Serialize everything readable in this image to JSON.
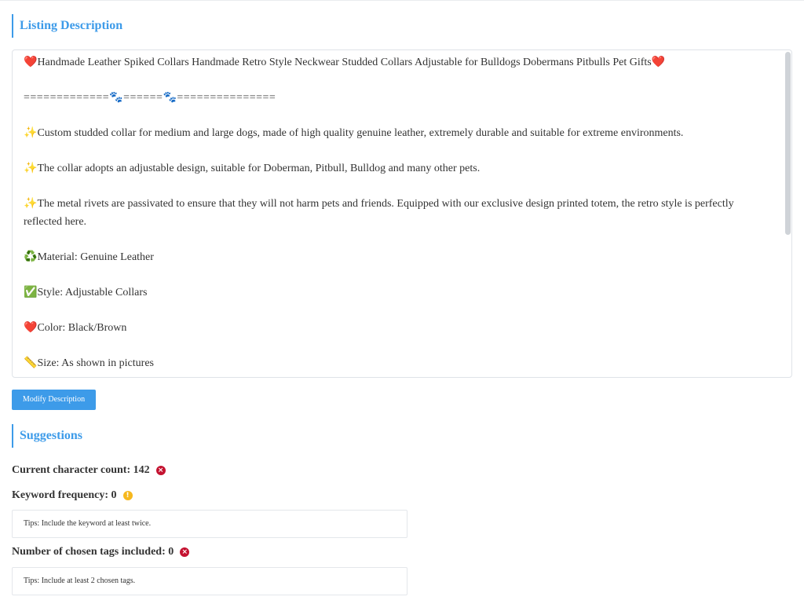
{
  "listing": {
    "title": "Listing Description",
    "lines": [
      {
        "icon": "❤️",
        "text": "Handmade Leather Spiked Collars Handmade Retro Style Neckwear Studded Collars Adjustable for Bulldogs Dobermans Pitbulls Pet Gifts",
        "end_icon": "❤️"
      },
      {
        "separator": "=============🐾======🐾==============="
      },
      {
        "icon": "✨",
        "text": "Custom studded collar for medium and large dogs, made of high quality genuine leather, extremely durable and suitable for extreme environments."
      },
      {
        "icon": "✨",
        "text": "The collar adopts an adjustable design, suitable for Doberman, Pitbull, Bulldog and many other pets."
      },
      {
        "icon": "✨",
        "text": "The metal rivets are passivated to ensure that they will not harm pets and friends. Equipped with our exclusive design printed totem, the retro style is perfectly reflected here."
      },
      {
        "icon": "♻️",
        "text": "Material: Genuine Leather"
      },
      {
        "icon": "✅",
        "text": "Style: Adjustable Collars"
      },
      {
        "icon": "❤️",
        "text": "Color: Black/Brown"
      },
      {
        "icon": "📏",
        "text": "Size: As shown in pictures"
      }
    ],
    "modify_button": "Modify Description"
  },
  "suggestions": {
    "title": "Suggestions",
    "char_count": {
      "label": "Current character count: 142",
      "status": "error"
    },
    "keyword_freq": {
      "label": "Keyword frequency: 0",
      "status": "warning",
      "tip": "Tips: Include the keyword at least twice."
    },
    "tags_included": {
      "label": "Number of chosen tags included: 0",
      "status": "error",
      "tip": "Tips: Include at least 2 chosen tags."
    }
  },
  "icons": {
    "error": "×",
    "warning": "!"
  },
  "colors": {
    "accent": "#3d9be9",
    "error": "#c41230",
    "warning": "#f6b81e"
  }
}
